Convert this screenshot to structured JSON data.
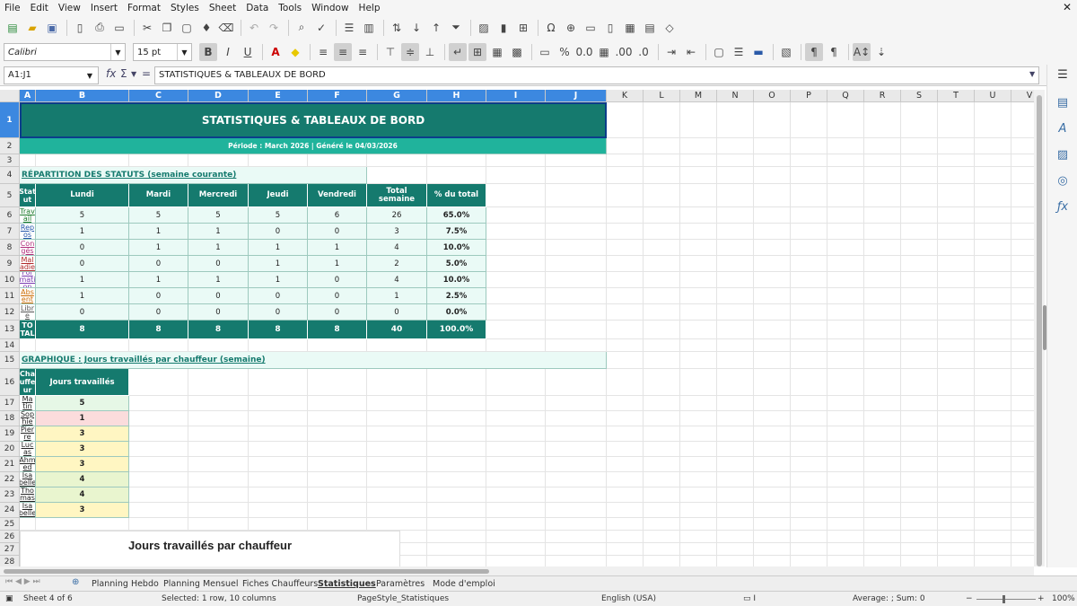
{
  "menu": [
    "File",
    "Edit",
    "View",
    "Insert",
    "Format",
    "Styles",
    "Sheet",
    "Data",
    "Tools",
    "Window",
    "Help"
  ],
  "format": {
    "font": "Calibri",
    "size": "15 pt",
    "bold": "B",
    "italic": "I",
    "underline": "U"
  },
  "formula": {
    "cell_ref": "A1:J1",
    "fx": "fx",
    "sigma": "Σ",
    "eq": "=",
    "content": "STATISTIQUES & TABLEAUX DE BORD"
  },
  "columns": [
    "A",
    "B",
    "C",
    "D",
    "E",
    "F",
    "G",
    "H",
    "I",
    "J",
    "K",
    "L",
    "M",
    "N",
    "O",
    "P",
    "Q",
    "R",
    "S",
    "T",
    "U",
    "V"
  ],
  "rows": [
    "1",
    "2",
    "3",
    "4",
    "5",
    "6",
    "7",
    "8",
    "9",
    "10",
    "11",
    "12",
    "13",
    "14",
    "15",
    "16",
    "17",
    "18",
    "19",
    "20",
    "21",
    "22",
    "23",
    "24",
    "25",
    "26",
    "27",
    "28"
  ],
  "sheet": {
    "title": "STATISTIQUES & TABLEAUX DE BORD",
    "subtitle": "Période : March 2026 | Généré le 04/03/2026",
    "section1": "RÉPARTITION DES STATUTS (semaine courante)",
    "status_table": {
      "headers": [
        "Stat ut",
        "Lundi",
        "Mardi",
        "Mercredi",
        "Jeudi",
        "Vendredi",
        "Total semaine",
        "% du total"
      ],
      "rows": [
        [
          "Trav ail",
          "5",
          "5",
          "5",
          "5",
          "6",
          "26",
          "65.0%"
        ],
        [
          "Rep os",
          "1",
          "1",
          "1",
          "0",
          "0",
          "3",
          "7.5%"
        ],
        [
          "Con gés",
          "0",
          "1",
          "1",
          "1",
          "1",
          "4",
          "10.0%"
        ],
        [
          "Mal adie",
          "0",
          "0",
          "0",
          "1",
          "1",
          "2",
          "5.0%"
        ],
        [
          "For mati on",
          "1",
          "1",
          "1",
          "1",
          "0",
          "4",
          "10.0%"
        ],
        [
          "Abs ent",
          "1",
          "0",
          "0",
          "0",
          "0",
          "1",
          "2.5%"
        ],
        [
          "Libr e",
          "0",
          "0",
          "0",
          "0",
          "0",
          "0",
          "0.0%"
        ]
      ],
      "total": [
        "TO TAL",
        "8",
        "8",
        "8",
        "8",
        "8",
        "40",
        "100.0%"
      ]
    },
    "section2": "GRAPHIQUE : Jours travaillés par chauffeur (semaine)",
    "driver_table": {
      "headers": [
        "Cha uffe ur",
        "Jours travaillés"
      ],
      "rows": [
        [
          "Ma tin",
          "5"
        ],
        [
          "Sop hie",
          "1"
        ],
        [
          "Pier re",
          "3"
        ],
        [
          "Luc as",
          "3"
        ],
        [
          "Ahm ed",
          "3"
        ],
        [
          "Isa belle",
          "4"
        ],
        [
          "Tho mas",
          "4"
        ],
        [
          "Isa belle",
          "3"
        ]
      ]
    },
    "chart_title": "Jours travaillés par chauffeur"
  },
  "tabs": [
    "Planning Hebdo",
    "Planning Mensuel",
    "Fiches Chauffeurs",
    "Statistiques",
    "Paramètres",
    "Mode d'emploi"
  ],
  "status": {
    "sheet": "Sheet 4 of 6",
    "selection": "Selected: 1 row, 10 columns",
    "page_style": "PageStyle_Statistiques",
    "language": "English (USA)",
    "summary": "Average: ; Sum: 0",
    "zoom": "100%"
  },
  "colors": {
    "teal_dark": "#157a6e",
    "teal_mid": "#20b39c",
    "teal_light": "#eafaf6",
    "header_sel": "#3c88e0"
  }
}
